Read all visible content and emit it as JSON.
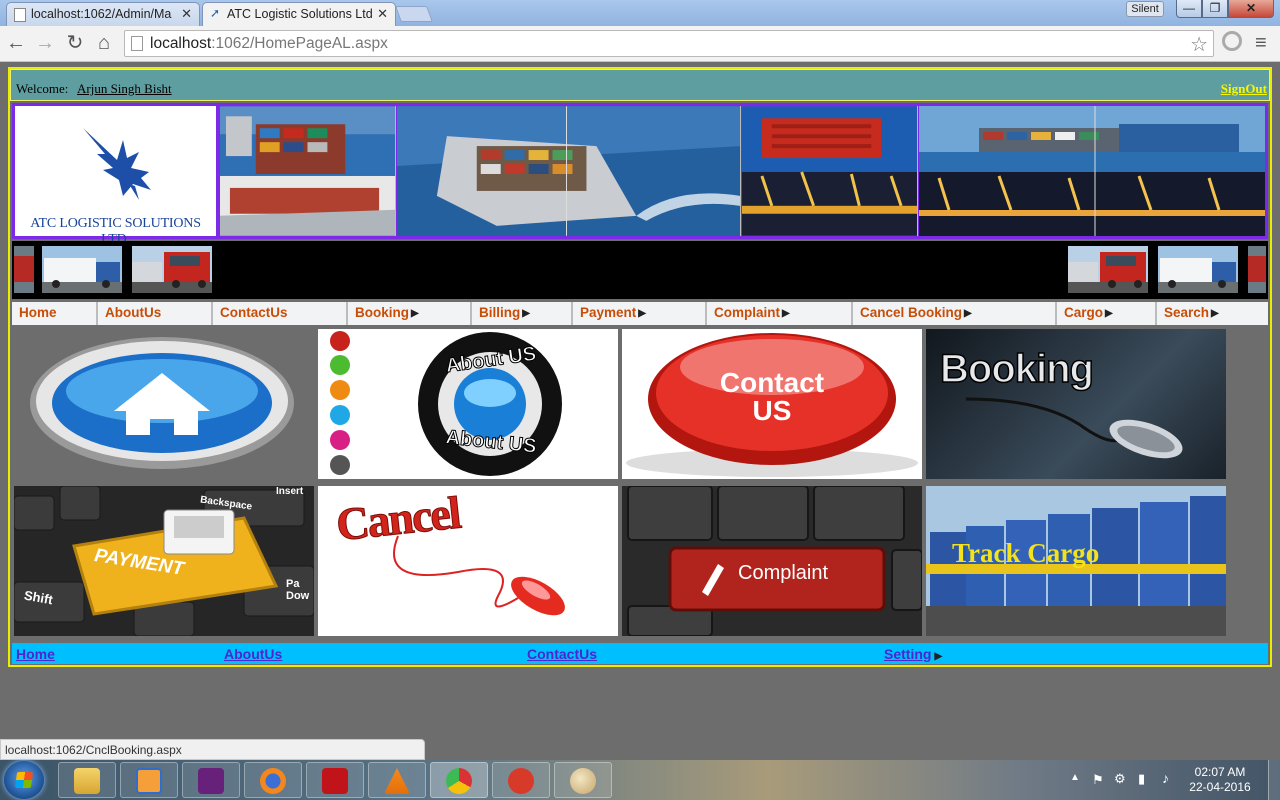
{
  "browser": {
    "tabs": [
      {
        "title": "localhost:1062/Admin/Ma",
        "active": false
      },
      {
        "title": "ATC Logistic Solutions Ltd",
        "active": true
      }
    ],
    "silent_badge": "Silent",
    "address": {
      "host": "localhost",
      "path": ":1062/HomePageAL.aspx"
    },
    "status_url": "localhost:1062/CnclBooking.aspx"
  },
  "header": {
    "welcome_label": "Welcome:",
    "user_name": "Arjun Singh Bisht",
    "signout": "SignOut"
  },
  "logo": {
    "company_name": "ATC LOGISTIC SOLUTIONS LTD."
  },
  "menu": {
    "items": [
      {
        "label": "Home",
        "submenu": false
      },
      {
        "label": "AboutUs",
        "submenu": false
      },
      {
        "label": "ContactUs",
        "submenu": false
      },
      {
        "label": "Booking",
        "submenu": true
      },
      {
        "label": "Billing",
        "submenu": true
      },
      {
        "label": "Payment",
        "submenu": true
      },
      {
        "label": "Complaint",
        "submenu": true
      },
      {
        "label": "Cancel Booking",
        "submenu": true
      },
      {
        "label": "Cargo",
        "submenu": true
      },
      {
        "label": "Search",
        "submenu": true
      }
    ]
  },
  "tiles": {
    "home": "home-icon",
    "about": {
      "top": "About US",
      "bottom": "About US"
    },
    "contact": {
      "line1": "Contact",
      "line2": "US"
    },
    "booking": "Booking",
    "payment": {
      "key": "PAYMENT",
      "backspace": "Backspace",
      "insert": "Insert",
      "shift": "Shift",
      "pgdn": "Pa Dow"
    },
    "cancel": "Cancel",
    "complaint": "Complaint",
    "track": "Track Cargo"
  },
  "footer": {
    "links": [
      {
        "label": "Home",
        "submenu": false
      },
      {
        "label": "AboutUs",
        "submenu": false
      },
      {
        "label": "ContactUs",
        "submenu": false
      },
      {
        "label": "Setting",
        "submenu": true
      }
    ]
  },
  "taskbar": {
    "clock": {
      "time": "02:07 AM",
      "date": "22-04-2016"
    }
  },
  "colors": {
    "welcome_bar": "#5f9ea0",
    "banner_border": "#7d2ae8",
    "menu_text": "#c84d07",
    "footer_bar": "#00bfff",
    "page_bg": "#6d6d6d",
    "page_border": "#e9ee00"
  }
}
